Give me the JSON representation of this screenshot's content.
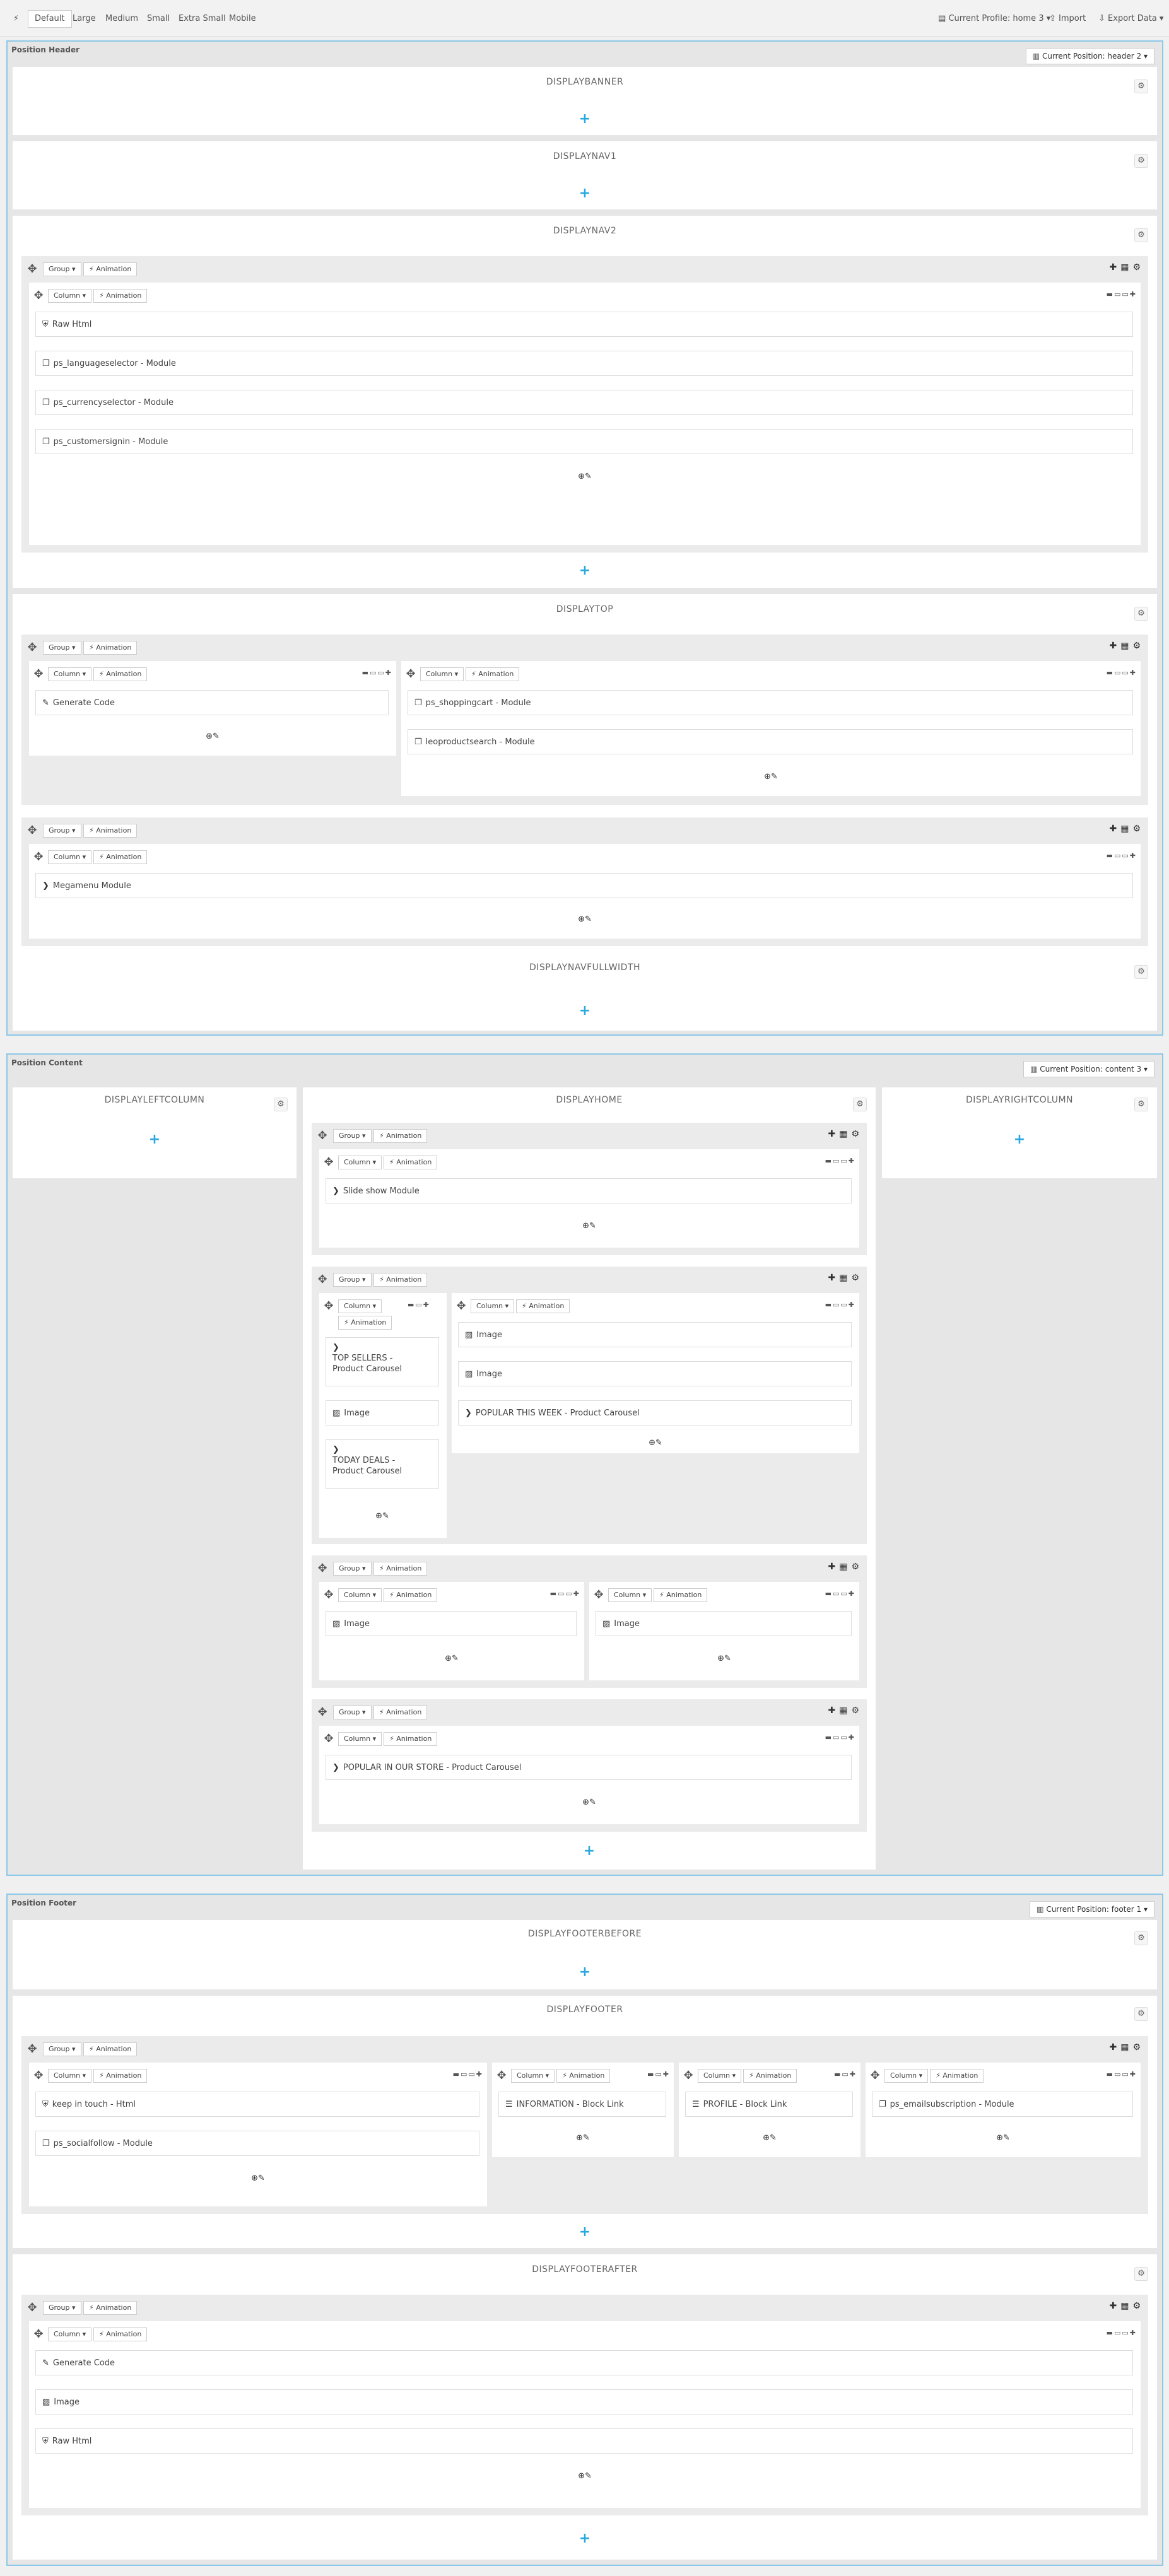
{
  "toolbar": {
    "toggle_icon": "magic-icon",
    "sizes": [
      "Default",
      "Large",
      "Medium",
      "Small",
      "Extra Small",
      "Mobile"
    ],
    "profile": "Current Profile: home 3",
    "import": "Import",
    "export": "Export Data"
  },
  "labels": {
    "group": "Group",
    "column": "Column",
    "animation": "Animation"
  },
  "header": {
    "title": "Position Header",
    "current": "Current Position: header 2",
    "hooks": {
      "banner": "DISPLAYBANNER",
      "nav1": "DISPLAYNAV1",
      "nav2": "DISPLAYNAV2",
      "top": "DISPLAYTOP",
      "navfull": "DISPLAYNAVFULLWIDTH"
    },
    "nav2_widgets": [
      "Raw Html",
      "ps_languageselector - Module",
      "ps_currencyselector - Module",
      "ps_customersignin - Module"
    ],
    "top_widgets": {
      "a": "Generate Code",
      "b1": "ps_shoppingcart - Module",
      "b2": "leoproductsearch - Module",
      "c": "Megamenu Module"
    }
  },
  "content": {
    "title": "Position Content",
    "current": "Current Position: content 3",
    "hooks": {
      "left": "DISPLAYLEFTCOLUMN",
      "home": "DISPLAYHOME",
      "right": "DISPLAYRIGHTCOLUMN"
    },
    "widgets": {
      "slide": "Slide show Module",
      "top_sellers_1": "TOP SELLERS -",
      "top_sellers_2": "Product Carousel",
      "image": "Image",
      "today_1": "TODAY DEALS -",
      "today_2": "Product Carousel",
      "popular_week": "POPULAR THIS WEEK - Product Carousel",
      "popular_store": "POPULAR IN OUR STORE - Product Carousel"
    }
  },
  "footer": {
    "title": "Position Footer",
    "current": "Current Position: footer 1",
    "hooks": {
      "before": "DISPLAYFOOTERBEFORE",
      "footer": "DISPLAYFOOTER",
      "after": "DISPLAYFOOTERAFTER"
    },
    "widgets": {
      "keep": "keep in touch - Html",
      "social": "ps_socialfollow - Module",
      "info": "INFORMATION - Block Link",
      "profile": "PROFILE - Block Link",
      "email": "ps_emailsubscription - Module",
      "gen": "Generate Code",
      "image": "Image",
      "raw": "Raw Html"
    }
  }
}
